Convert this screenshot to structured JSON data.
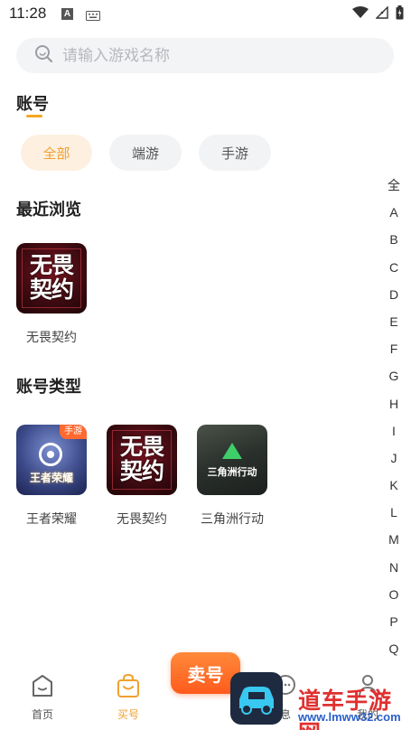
{
  "status_bar": {
    "time": "11:28",
    "a_badge": "A"
  },
  "search": {
    "placeholder": "请输入游戏名称"
  },
  "account": {
    "title": "账号",
    "filters": [
      {
        "label": "全部",
        "active": true
      },
      {
        "label": "端游",
        "active": false
      },
      {
        "label": "手游",
        "active": false
      }
    ]
  },
  "recent": {
    "title": "最近浏览",
    "items": [
      {
        "name": "无畏契约",
        "logo_line1": "无畏",
        "logo_line2": "契约"
      }
    ]
  },
  "types": {
    "title": "账号类型",
    "items": [
      {
        "name": "王者荣耀",
        "logo_text": "王者荣耀",
        "badge": "手游"
      },
      {
        "name": "无畏契约",
        "logo_line1": "无畏",
        "logo_line2": "契约"
      },
      {
        "name": "三角洲行动",
        "logo_text": "三角洲行动"
      }
    ]
  },
  "alpha_index": [
    "全",
    "A",
    "B",
    "C",
    "D",
    "E",
    "F",
    "G",
    "H",
    "I",
    "J",
    "K",
    "L",
    "M",
    "N",
    "O",
    "P",
    "Q"
  ],
  "nav": {
    "home": "首页",
    "buy": "买号",
    "sell": "卖号",
    "message": "息",
    "mine": "我的"
  },
  "watermark": {
    "text": "道车手游网",
    "url": "www.lmww32.com"
  },
  "colors": {
    "accent": "#f0a030",
    "sell": "#ff5a1c"
  }
}
